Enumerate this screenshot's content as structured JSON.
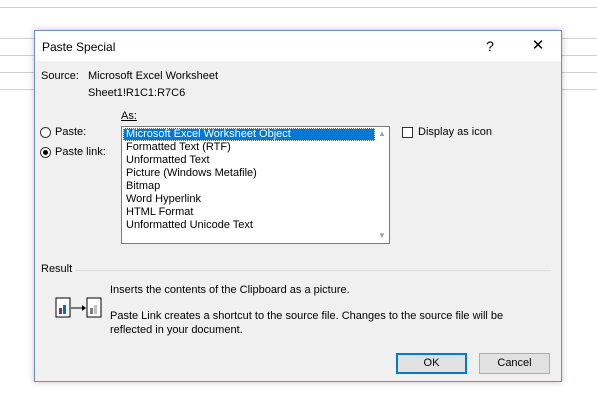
{
  "dialog": {
    "title": "Paste Special",
    "help_glyph": "?",
    "close_glyph": "✕"
  },
  "source": {
    "label": "Source:",
    "value": "Microsoft Excel Worksheet",
    "range": "Sheet1!R1C1:R7C6"
  },
  "as_label": "As:",
  "options": {
    "paste_label": "Paste:",
    "paste_link_label": "Paste link:",
    "selected": "paste_link"
  },
  "list": {
    "items": [
      "Microsoft Excel Worksheet Object",
      "Formatted Text (RTF)",
      "Unformatted Text",
      "Picture (Windows Metafile)",
      "Bitmap",
      "Word Hyperlink",
      "HTML Format",
      "Unformatted Unicode Text"
    ],
    "selected_index": 0
  },
  "display_as_icon": {
    "label": "Display as icon",
    "checked": false
  },
  "result": {
    "label": "Result",
    "line1": "Inserts the contents of the Clipboard as a picture.",
    "line2": "Paste Link creates a shortcut to the source file. Changes to the source file will be reflected in your document."
  },
  "buttons": {
    "ok": "OK",
    "cancel": "Cancel"
  },
  "colors": {
    "selection": "#0078d7",
    "dialog_border": "#6f8fc0",
    "dialog_bg": "#f0f0f0"
  }
}
